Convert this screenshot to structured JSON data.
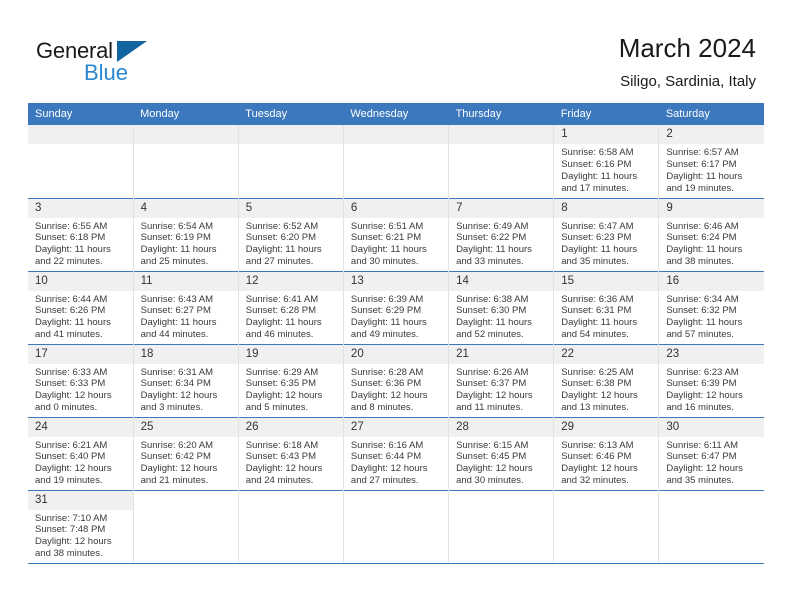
{
  "brand": {
    "name_part1": "General",
    "name_part2": "Blue",
    "triangle_icon": "triangle-icon"
  },
  "header": {
    "title": "March 2024",
    "subtitle": "Siligo, Sardinia, Italy"
  },
  "colors": {
    "header_blue": "#3b78bd",
    "daynum_band": "#f0f0f0",
    "logo_blue": "#2a87d0",
    "triangle_blue": "#12659e",
    "text": "#3a3a3a"
  },
  "weekday_headers": [
    "Sunday",
    "Monday",
    "Tuesday",
    "Wednesday",
    "Thursday",
    "Friday",
    "Saturday"
  ],
  "labels": {
    "sunrise_prefix": "Sunrise:",
    "sunset_prefix": "Sunset:",
    "daylight_prefix": "Daylight:"
  },
  "weeks": [
    [
      {
        "blank": true
      },
      {
        "blank": true
      },
      {
        "blank": true
      },
      {
        "blank": true
      },
      {
        "blank": true
      },
      {
        "day": "1",
        "sunrise": "Sunrise: 6:58 AM",
        "sunset": "Sunset: 6:16 PM",
        "daylight_line1": "Daylight: 11 hours",
        "daylight_line2": "and 17 minutes."
      },
      {
        "day": "2",
        "sunrise": "Sunrise: 6:57 AM",
        "sunset": "Sunset: 6:17 PM",
        "daylight_line1": "Daylight: 11 hours",
        "daylight_line2": "and 19 minutes."
      }
    ],
    [
      {
        "day": "3",
        "sunrise": "Sunrise: 6:55 AM",
        "sunset": "Sunset: 6:18 PM",
        "daylight_line1": "Daylight: 11 hours",
        "daylight_line2": "and 22 minutes."
      },
      {
        "day": "4",
        "sunrise": "Sunrise: 6:54 AM",
        "sunset": "Sunset: 6:19 PM",
        "daylight_line1": "Daylight: 11 hours",
        "daylight_line2": "and 25 minutes."
      },
      {
        "day": "5",
        "sunrise": "Sunrise: 6:52 AM",
        "sunset": "Sunset: 6:20 PM",
        "daylight_line1": "Daylight: 11 hours",
        "daylight_line2": "and 27 minutes."
      },
      {
        "day": "6",
        "sunrise": "Sunrise: 6:51 AM",
        "sunset": "Sunset: 6:21 PM",
        "daylight_line1": "Daylight: 11 hours",
        "daylight_line2": "and 30 minutes."
      },
      {
        "day": "7",
        "sunrise": "Sunrise: 6:49 AM",
        "sunset": "Sunset: 6:22 PM",
        "daylight_line1": "Daylight: 11 hours",
        "daylight_line2": "and 33 minutes."
      },
      {
        "day": "8",
        "sunrise": "Sunrise: 6:47 AM",
        "sunset": "Sunset: 6:23 PM",
        "daylight_line1": "Daylight: 11 hours",
        "daylight_line2": "and 35 minutes."
      },
      {
        "day": "9",
        "sunrise": "Sunrise: 6:46 AM",
        "sunset": "Sunset: 6:24 PM",
        "daylight_line1": "Daylight: 11 hours",
        "daylight_line2": "and 38 minutes."
      }
    ],
    [
      {
        "day": "10",
        "sunrise": "Sunrise: 6:44 AM",
        "sunset": "Sunset: 6:26 PM",
        "daylight_line1": "Daylight: 11 hours",
        "daylight_line2": "and 41 minutes."
      },
      {
        "day": "11",
        "sunrise": "Sunrise: 6:43 AM",
        "sunset": "Sunset: 6:27 PM",
        "daylight_line1": "Daylight: 11 hours",
        "daylight_line2": "and 44 minutes."
      },
      {
        "day": "12",
        "sunrise": "Sunrise: 6:41 AM",
        "sunset": "Sunset: 6:28 PM",
        "daylight_line1": "Daylight: 11 hours",
        "daylight_line2": "and 46 minutes."
      },
      {
        "day": "13",
        "sunrise": "Sunrise: 6:39 AM",
        "sunset": "Sunset: 6:29 PM",
        "daylight_line1": "Daylight: 11 hours",
        "daylight_line2": "and 49 minutes."
      },
      {
        "day": "14",
        "sunrise": "Sunrise: 6:38 AM",
        "sunset": "Sunset: 6:30 PM",
        "daylight_line1": "Daylight: 11 hours",
        "daylight_line2": "and 52 minutes."
      },
      {
        "day": "15",
        "sunrise": "Sunrise: 6:36 AM",
        "sunset": "Sunset: 6:31 PM",
        "daylight_line1": "Daylight: 11 hours",
        "daylight_line2": "and 54 minutes."
      },
      {
        "day": "16",
        "sunrise": "Sunrise: 6:34 AM",
        "sunset": "Sunset: 6:32 PM",
        "daylight_line1": "Daylight: 11 hours",
        "daylight_line2": "and 57 minutes."
      }
    ],
    [
      {
        "day": "17",
        "sunrise": "Sunrise: 6:33 AM",
        "sunset": "Sunset: 6:33 PM",
        "daylight_line1": "Daylight: 12 hours",
        "daylight_line2": "and 0 minutes."
      },
      {
        "day": "18",
        "sunrise": "Sunrise: 6:31 AM",
        "sunset": "Sunset: 6:34 PM",
        "daylight_line1": "Daylight: 12 hours",
        "daylight_line2": "and 3 minutes."
      },
      {
        "day": "19",
        "sunrise": "Sunrise: 6:29 AM",
        "sunset": "Sunset: 6:35 PM",
        "daylight_line1": "Daylight: 12 hours",
        "daylight_line2": "and 5 minutes."
      },
      {
        "day": "20",
        "sunrise": "Sunrise: 6:28 AM",
        "sunset": "Sunset: 6:36 PM",
        "daylight_line1": "Daylight: 12 hours",
        "daylight_line2": "and 8 minutes."
      },
      {
        "day": "21",
        "sunrise": "Sunrise: 6:26 AM",
        "sunset": "Sunset: 6:37 PM",
        "daylight_line1": "Daylight: 12 hours",
        "daylight_line2": "and 11 minutes."
      },
      {
        "day": "22",
        "sunrise": "Sunrise: 6:25 AM",
        "sunset": "Sunset: 6:38 PM",
        "daylight_line1": "Daylight: 12 hours",
        "daylight_line2": "and 13 minutes."
      },
      {
        "day": "23",
        "sunrise": "Sunrise: 6:23 AM",
        "sunset": "Sunset: 6:39 PM",
        "daylight_line1": "Daylight: 12 hours",
        "daylight_line2": "and 16 minutes."
      }
    ],
    [
      {
        "day": "24",
        "sunrise": "Sunrise: 6:21 AM",
        "sunset": "Sunset: 6:40 PM",
        "daylight_line1": "Daylight: 12 hours",
        "daylight_line2": "and 19 minutes."
      },
      {
        "day": "25",
        "sunrise": "Sunrise: 6:20 AM",
        "sunset": "Sunset: 6:42 PM",
        "daylight_line1": "Daylight: 12 hours",
        "daylight_line2": "and 21 minutes."
      },
      {
        "day": "26",
        "sunrise": "Sunrise: 6:18 AM",
        "sunset": "Sunset: 6:43 PM",
        "daylight_line1": "Daylight: 12 hours",
        "daylight_line2": "and 24 minutes."
      },
      {
        "day": "27",
        "sunrise": "Sunrise: 6:16 AM",
        "sunset": "Sunset: 6:44 PM",
        "daylight_line1": "Daylight: 12 hours",
        "daylight_line2": "and 27 minutes."
      },
      {
        "day": "28",
        "sunrise": "Sunrise: 6:15 AM",
        "sunset": "Sunset: 6:45 PM",
        "daylight_line1": "Daylight: 12 hours",
        "daylight_line2": "and 30 minutes."
      },
      {
        "day": "29",
        "sunrise": "Sunrise: 6:13 AM",
        "sunset": "Sunset: 6:46 PM",
        "daylight_line1": "Daylight: 12 hours",
        "daylight_line2": "and 32 minutes."
      },
      {
        "day": "30",
        "sunrise": "Sunrise: 6:11 AM",
        "sunset": "Sunset: 6:47 PM",
        "daylight_line1": "Daylight: 12 hours",
        "daylight_line2": "and 35 minutes."
      }
    ],
    [
      {
        "day": "31",
        "sunrise": "Sunrise: 7:10 AM",
        "sunset": "Sunset: 7:48 PM",
        "daylight_line1": "Daylight: 12 hours",
        "daylight_line2": "and 38 minutes."
      },
      {
        "empty": true
      },
      {
        "empty": true
      },
      {
        "empty": true
      },
      {
        "empty": true
      },
      {
        "empty": true
      },
      {
        "empty": true
      }
    ]
  ]
}
